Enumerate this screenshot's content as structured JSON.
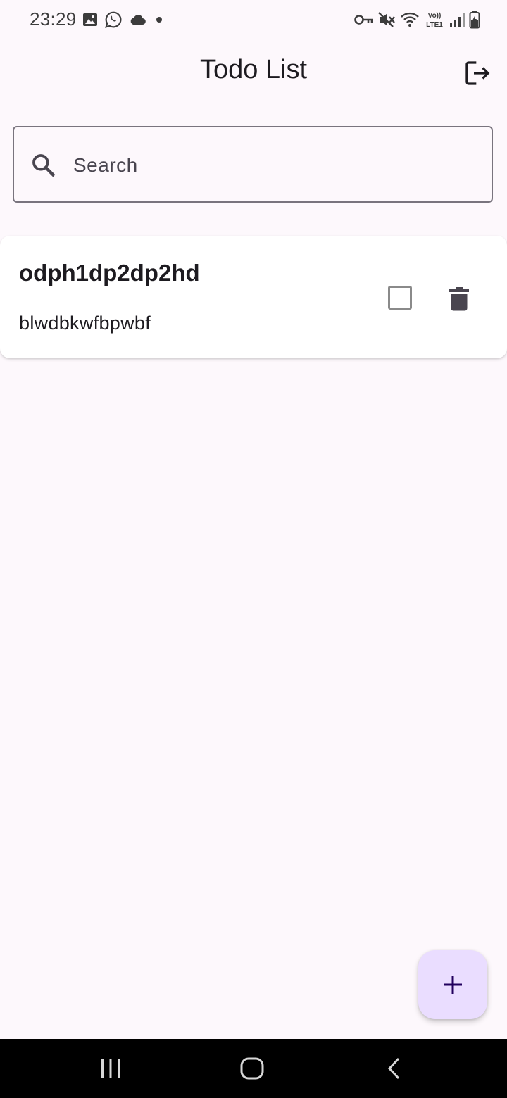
{
  "status_bar": {
    "time": "23:29",
    "left_icons": [
      "image-icon",
      "whatsapp-icon",
      "cloud-icon",
      "dot-icon"
    ],
    "right_icons": [
      "vpn-key-icon",
      "mute-icon",
      "wifi-icon",
      "volte-icon",
      "signal-icon",
      "battery-charging-icon"
    ],
    "volte_top": "Vo))",
    "volte_bottom": "LTE1"
  },
  "app_bar": {
    "title": "Todo List",
    "logout_icon": "logout-icon"
  },
  "search": {
    "placeholder": "Search",
    "value": "",
    "icon": "search-icon"
  },
  "todos": [
    {
      "title": "odph1dp2dp2hd",
      "description": "blwdbkwfbpwbf",
      "completed": false
    }
  ],
  "fab": {
    "icon": "plus-icon",
    "background": "#eaddff"
  },
  "nav_bar": {
    "icons": [
      "recent-apps-icon",
      "home-icon",
      "back-icon"
    ]
  },
  "colors": {
    "background": "#fdf8fc",
    "card": "#ffffff",
    "outline": "#79747e",
    "text": "#1d1b20",
    "fab_icon": "#21005d"
  }
}
